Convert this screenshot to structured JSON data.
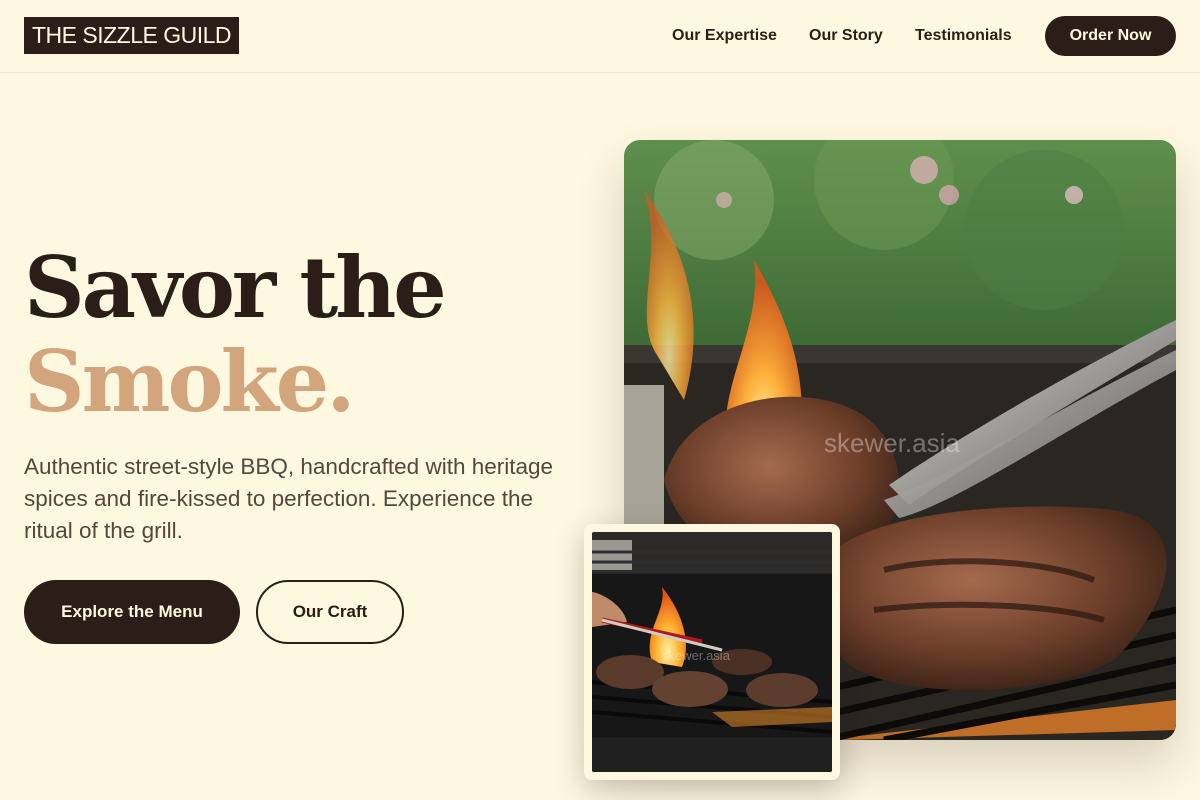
{
  "header": {
    "logo": "THE SIZZLE GUILD",
    "nav": [
      "Our Expertise",
      "Our Story",
      "Testimonials"
    ],
    "cta": "Order Now"
  },
  "hero": {
    "headline_line1": "Savor the",
    "headline_line2": "Smoke.",
    "subtitle": "Authentic street-style BBQ, handcrafted with heritage spices and fire-kissed to perfection. Experience the ritual of the grill.",
    "primary_button": "Explore the Menu",
    "secondary_button": "Our Craft"
  },
  "images": {
    "main_watermark": "skewer.asia",
    "thumb_watermark": "skewer.asia"
  },
  "colors": {
    "background": "#fef8e1",
    "primary": "#2b1d17",
    "accent": "#d2a57d",
    "text_muted": "#56463d"
  }
}
